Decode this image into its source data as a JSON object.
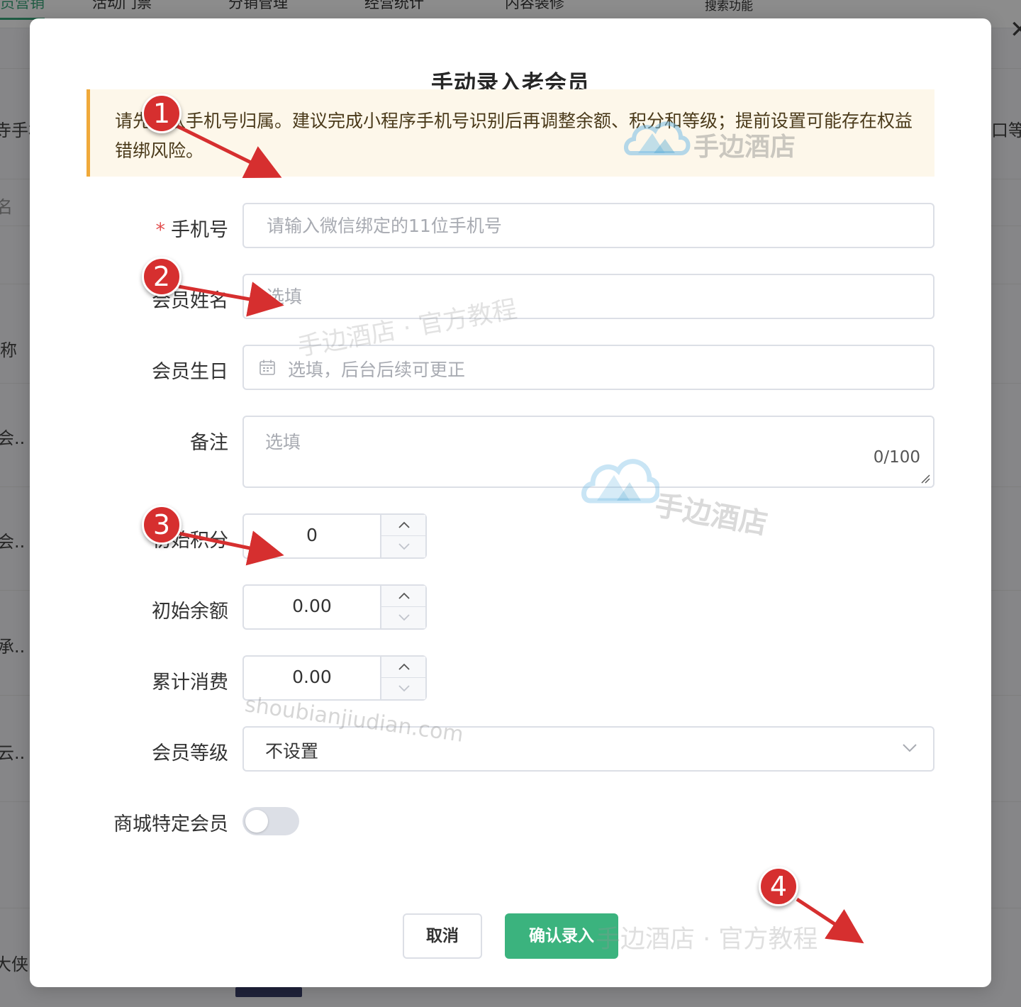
{
  "background": {
    "nav_items": [
      "员营销",
      "活动门票",
      "分销管理",
      "经营统计",
      "内容装修",
      "搜索功能"
    ],
    "side_texts": [
      "寺手机",
      "名",
      "称",
      "会..",
      "会..",
      "承..",
      "云..",
      "大侠"
    ],
    "right_text": "口等级"
  },
  "modal": {
    "title": "手动录入老会员",
    "notice": "请先确认手机号归属。建议完成小程序手机号识别后再调整余额、积分和等级；提前设置可能存在权益错绑风险。",
    "fields": {
      "phone": {
        "label": "手机号",
        "required_mark": "*",
        "placeholder": "请输入微信绑定的11位手机号",
        "value": ""
      },
      "name": {
        "label": "会员姓名",
        "placeholder": "选填",
        "value": ""
      },
      "birthday": {
        "label": "会员生日",
        "placeholder": "选填，后台后续可更正"
      },
      "remark": {
        "label": "备注",
        "placeholder": "选填",
        "counter": "0/100"
      },
      "points": {
        "label": "初始积分",
        "value": "0"
      },
      "balance": {
        "label": "初始余额",
        "value": "0.00"
      },
      "total_spent": {
        "label": "累计消费",
        "value": "0.00"
      },
      "level": {
        "label": "会员等级",
        "value": "不设置"
      },
      "mall_member": {
        "label": "商城特定会员",
        "enabled": false
      }
    },
    "buttons": {
      "cancel": "取消",
      "confirm": "确认录入"
    }
  },
  "watermarks": {
    "tutorial": "手边酒店 · 官方教程",
    "brand": "手边酒店",
    "domain": "shoubianjiudian.com"
  },
  "annotations": [
    "1",
    "2",
    "3",
    "4"
  ],
  "colors": {
    "primary_green": "#3bb37e",
    "notice_border": "#f0a93a",
    "notice_bg": "#fdf7ea",
    "annotation_red": "#d62f2f",
    "required_star": "#e24f4f"
  }
}
